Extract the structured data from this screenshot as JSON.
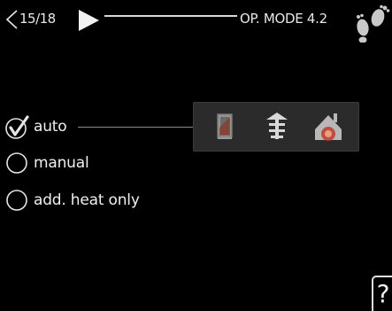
{
  "header": {
    "page_counter": "15/18",
    "menu_title": "OP. MODE 4.2",
    "nav_prev_icon": "chevron-left-icon",
    "nav_next_icon": "play-arrow-icon",
    "status_icon": "footsteps-icon"
  },
  "options": [
    {
      "label": "auto",
      "selected": true
    },
    {
      "label": "manual",
      "selected": false
    },
    {
      "label": "add. heat only",
      "selected": false
    }
  ],
  "function_icons": [
    "heating-icon",
    "additional-heat-icon",
    "house-heat-icon"
  ],
  "help": {
    "label": "?"
  },
  "colors": {
    "background": "#000000",
    "text": "#f0f0f0",
    "panel": "#2b2b2b"
  }
}
